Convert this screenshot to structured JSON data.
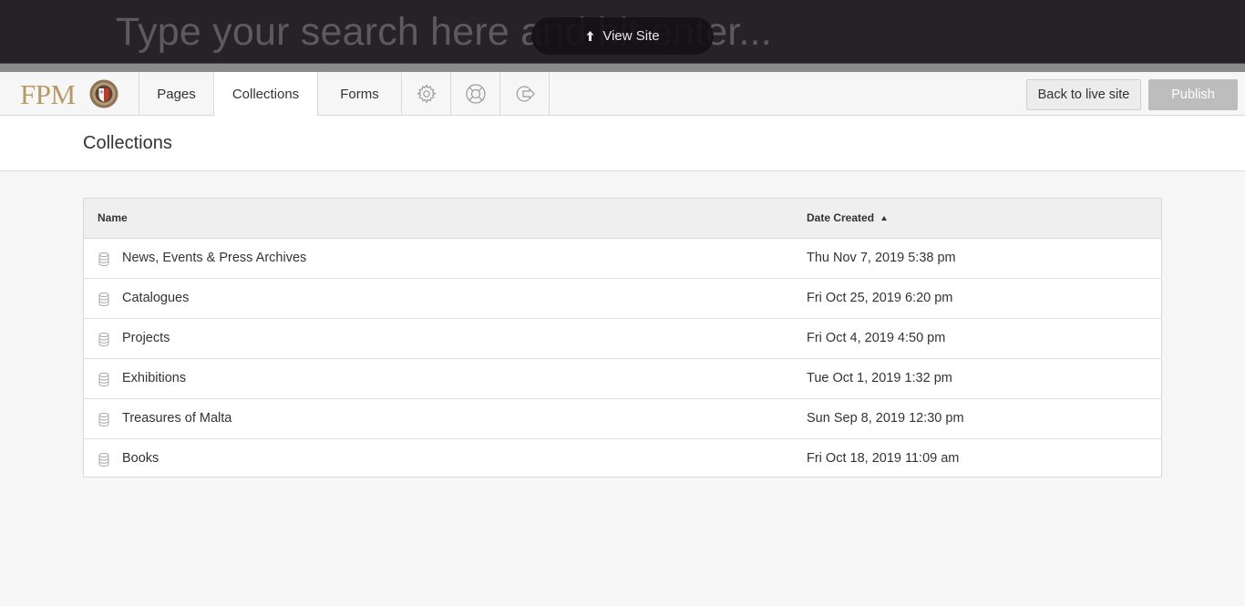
{
  "search": {
    "placeholder": "Type your search here and hit enter...",
    "view_site_label": "View Site"
  },
  "logo": {
    "text": "FPM"
  },
  "nav": {
    "tabs": [
      {
        "label": "Pages"
      },
      {
        "label": "Collections"
      },
      {
        "label": "Forms"
      }
    ],
    "icons": [
      "gear-icon",
      "lifebuoy-icon",
      "logout-icon"
    ],
    "back_label": "Back to live site",
    "publish_label": "Publish"
  },
  "page": {
    "title": "Collections"
  },
  "table": {
    "columns": [
      {
        "label": "Name"
      },
      {
        "label": "Date Created",
        "sort": "ascending"
      }
    ],
    "rows": [
      {
        "name": "News, Events & Press Archives",
        "date": "Thu Nov 7, 2019 5:38 pm"
      },
      {
        "name": "Catalogues",
        "date": "Fri Oct 25, 2019 6:20 pm"
      },
      {
        "name": "Projects",
        "date": "Fri Oct 4, 2019 4:50 pm"
      },
      {
        "name": "Exhibitions",
        "date": "Tue Oct 1, 2019 1:32 pm"
      },
      {
        "name": "Treasures of Malta",
        "date": "Sun Sep 8, 2019 12:30 pm"
      },
      {
        "name": "Books",
        "date": "Fri Oct 18, 2019 11:09 am"
      }
    ],
    "row_icon": "database-icon"
  },
  "colors": {
    "search_bar_bg": "#272227",
    "logo_gold": "#b59a66",
    "publish_disabled": "#bdbdbd"
  }
}
